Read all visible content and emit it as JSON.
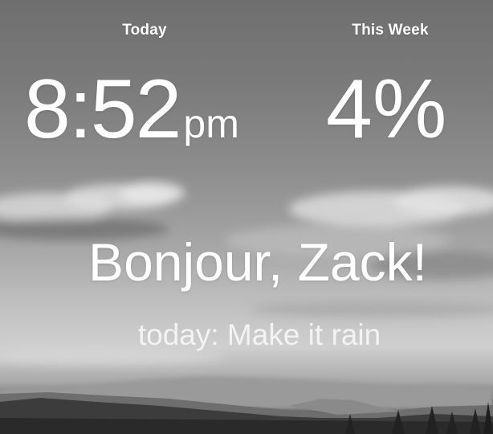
{
  "header": {
    "today_label": "Today",
    "week_label": "This Week"
  },
  "clock": {
    "time": "8:52",
    "ampm": "pm"
  },
  "week": {
    "percent": "4%"
  },
  "greeting": "Bonjour, Zack!",
  "focus": "today: Make it rain",
  "colors": {
    "text": "#ffffff",
    "sky": "#7b7b7b",
    "horizon": "#cfcfcf",
    "ground": "#3a3a3a"
  },
  "icons": []
}
